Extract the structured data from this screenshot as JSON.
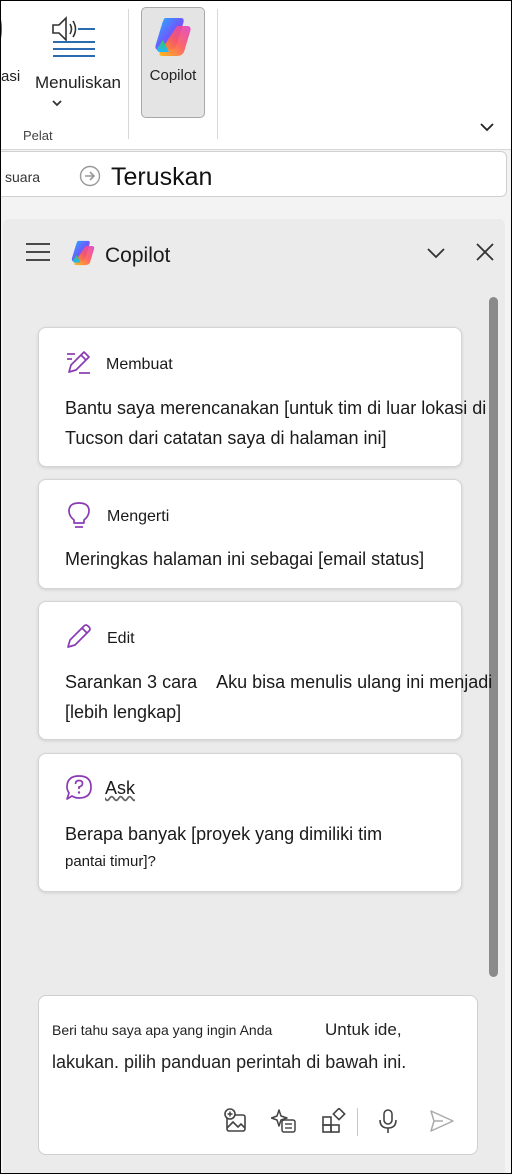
{
  "ribbon": {
    "partial_label": "asi",
    "mic_button_label": "Menuliskan",
    "group_label": "Pelat",
    "copilot_button_label": "Copilot"
  },
  "forward_bar": {
    "partial_label": "suara",
    "label": "Teruskan"
  },
  "pane": {
    "title": "Copilot"
  },
  "cards": [
    {
      "label": "Membuat",
      "line1": "Bantu saya merencanakan [untuk tim di luar lokasi di",
      "line2": "Tucson dari catatan saya di halaman ini]",
      "icon": "pen-sparkle-icon"
    },
    {
      "label": "Mengerti",
      "line1": "Meringkas halaman ini sebagai [email status]",
      "line2": "",
      "icon": "lightbulb-icon"
    },
    {
      "label": "Edit",
      "line1": "Sarankan 3 cara    Aku bisa menulis ulang ini menjadi",
      "line2": "[lebih lengkap]",
      "icon": "pencil-icon"
    },
    {
      "label": "Ask",
      "line1": "Berapa banyak [proyek yang dimiliki tim",
      "line2": "pantai timur]?",
      "icon": "question-icon"
    }
  ],
  "input": {
    "hint_part1": "Beri tahu saya apa yang ingin Anda",
    "hint_part2": "Untuk ide,",
    "hint_part3": "lakukan. pilih panduan perintah di bawah ini."
  },
  "colors": {
    "accent_purple": "#8a3ab4",
    "ribbon_blue": "#2b6cb0"
  }
}
